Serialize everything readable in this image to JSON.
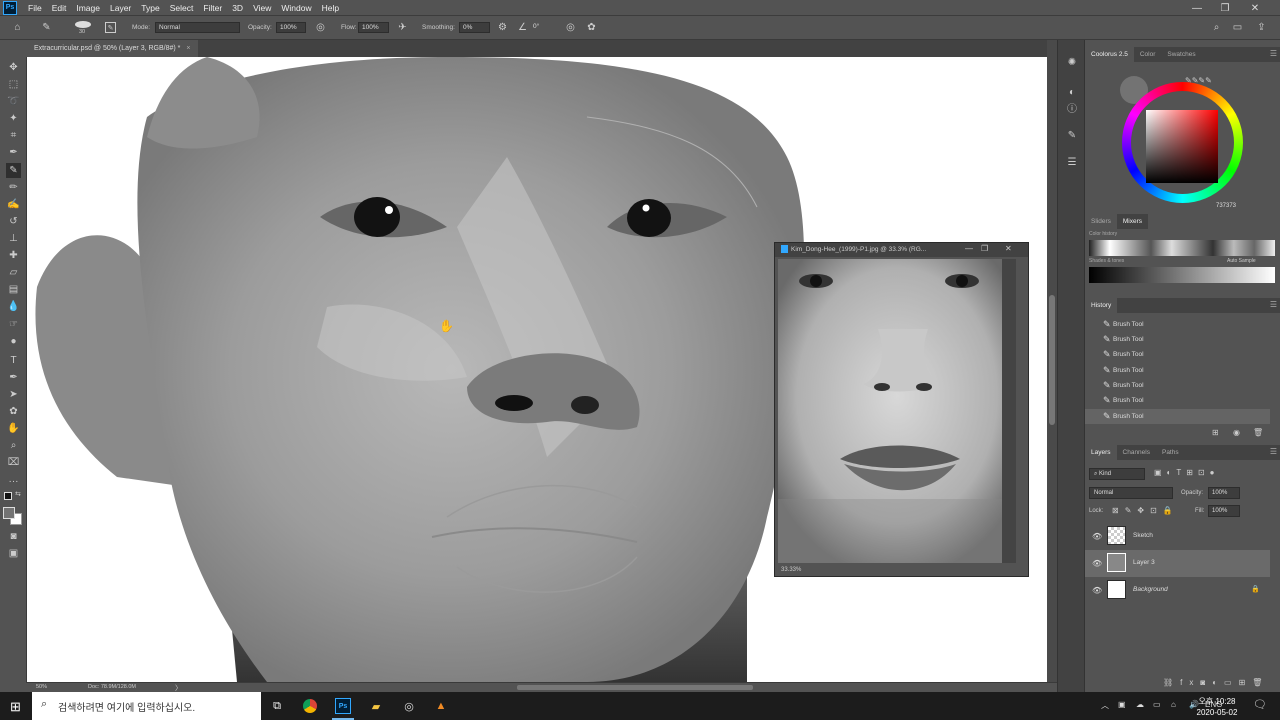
{
  "app": {
    "logo_text": "Ps",
    "menu": [
      "File",
      "Edit",
      "Image",
      "Layer",
      "Type",
      "Select",
      "Filter",
      "3D",
      "View",
      "Window",
      "Help"
    ],
    "window_controls": [
      "—",
      "❐",
      "✕"
    ]
  },
  "options_bar": {
    "brush_size": "30",
    "mode_label": "Mode:",
    "mode_value": "Normal",
    "opacity_label": "Opacity:",
    "opacity_value": "100%",
    "flow_label": "Flow:",
    "flow_value": "100%",
    "smoothing_label": "Smoothing:",
    "smoothing_value": "0%",
    "angle_value": "0°"
  },
  "document": {
    "tab_title": "Extracurricular.psd @ 50% (Layer 3, RGB/8#) *",
    "tab_close": "×",
    "zoom": "50%",
    "doc_info": "Doc: 78.9M/128.0M"
  },
  "reference_window": {
    "title": "Kim_Dong-Hee_(1999)-P1.jpg @ 33.3% (RG...",
    "zoom": "33.33%"
  },
  "coolorus": {
    "tabs": [
      "Coolorus 2.5",
      "Color",
      "Swatches"
    ],
    "hex_value": "737373",
    "sub_tabs": [
      "Sliders",
      "Mixers"
    ],
    "mixer_label": "Color history",
    "shades_label": "Shades & tones",
    "auto_sample": "Auto Sample"
  },
  "history": {
    "title": "History",
    "items": [
      "Brush Tool",
      "Brush Tool",
      "Brush Tool",
      "Brush Tool",
      "Brush Tool",
      "Brush Tool",
      "Brush Tool"
    ]
  },
  "layers": {
    "tabs": [
      "Layers",
      "Channels",
      "Paths"
    ],
    "filter_kind": "Kind",
    "blend_mode": "Normal",
    "opacity_label": "Opacity:",
    "opacity_value": "100%",
    "lock_label": "Lock:",
    "fill_label": "Fill:",
    "fill_value": "100%",
    "items": [
      {
        "name": "Sketch"
      },
      {
        "name": "Layer 3"
      },
      {
        "name": "Background"
      }
    ]
  },
  "taskbar": {
    "search_placeholder": "검색하려면 여기에 입력하십시오.",
    "language": "ENG",
    "time": "오후 10:28",
    "date": "2020-05-02"
  },
  "colors": {
    "ps_blue": "#31a8ff",
    "current_color": "#737373"
  }
}
